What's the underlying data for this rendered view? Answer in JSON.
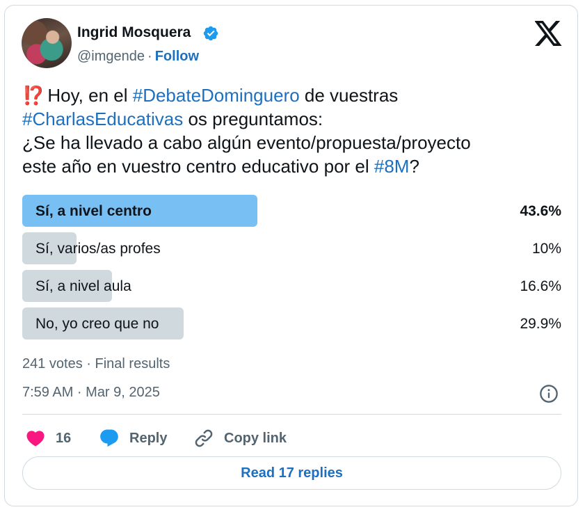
{
  "author": {
    "name": "Ingrid Mosquera",
    "handle": "@imgende",
    "separator": "·",
    "follow_label": "Follow"
  },
  "tweet": {
    "emoji": "⁉️",
    "line1_a": "Hoy, en el ",
    "hashtag1": "#DebateDominguero",
    "line1_b": " de vuestras",
    "hashtag2": "#CharlasEducativas",
    "line2_b": " os preguntamos:",
    "line3": "¿Se ha llevado a cabo algún evento/propuesta/proyecto",
    "line4_a": "este año en vuestro centro educativo por el ",
    "hashtag3": "#8M",
    "line4_b": "?"
  },
  "poll": {
    "options": [
      {
        "label": "Sí, a nivel centro",
        "percent_label": "43.6%",
        "percent": 43.6,
        "winner": true
      },
      {
        "label": "Sí, varios/as profes",
        "percent_label": "10%",
        "percent": 10,
        "winner": false
      },
      {
        "label": "Sí, a nivel aula",
        "percent_label": "16.6%",
        "percent": 16.6,
        "winner": false
      },
      {
        "label": "No, yo creo que no",
        "percent_label": "29.9%",
        "percent": 29.9,
        "winner": false
      }
    ],
    "meta": "241 votes · Final results"
  },
  "timestamp": "7:59 AM · Mar 9, 2025",
  "actions": {
    "like_count": "16",
    "reply_label": "Reply",
    "copy_label": "Copy link"
  },
  "read_replies_label": "Read 17 replies",
  "colors": {
    "accent": "#1d6fbf",
    "winner_bar": "#78c0f4",
    "bar": "#cfd9de",
    "like": "#f91880",
    "verified": "#1d9bf0"
  },
  "icons": [
    "verified-badge-icon",
    "x-logo-icon",
    "info-icon",
    "heart-icon",
    "reply-bubble-icon",
    "link-icon"
  ]
}
